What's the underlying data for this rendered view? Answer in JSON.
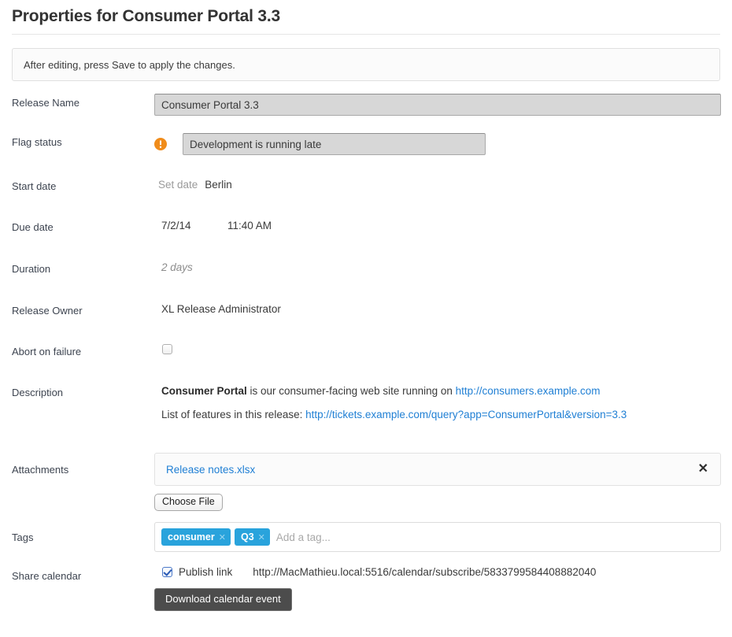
{
  "header": {
    "title": "Properties for Consumer Portal 3.3"
  },
  "banner": {
    "message": "After editing, press Save to apply the changes."
  },
  "fields": {
    "release_name": {
      "label": "Release Name",
      "value": "Consumer Portal 3.3"
    },
    "flag_status": {
      "label": "Flag status",
      "icon": "warning-exclamation-icon",
      "icon_color": "#f08c1b",
      "value": "Development is running late"
    },
    "start_date": {
      "label": "Start date",
      "placeholder": "Set date",
      "timezone": "Berlin"
    },
    "due_date": {
      "label": "Due date",
      "date": "7/2/14",
      "time": "11:40 AM"
    },
    "duration": {
      "label": "Duration",
      "value": "2 days"
    },
    "release_owner": {
      "label": "Release Owner",
      "value": "XL Release Administrator"
    },
    "abort_on_failure": {
      "label": "Abort on failure",
      "checked": false
    },
    "description": {
      "label": "Description",
      "line1_strong": "Consumer Portal",
      "line1_text": " is our consumer-facing web site running on ",
      "line1_link": "http://consumers.example.com",
      "line2_text": "List of features in this release: ",
      "line2_link": "http://tickets.example.com/query?app=ConsumerPortal&version=3.3"
    },
    "attachments": {
      "label": "Attachments",
      "file_name": "Release notes.xlsx",
      "remove_icon": "close-icon",
      "choose_file_label": "Choose File"
    },
    "tags": {
      "label": "Tags",
      "items": [
        "consumer",
        "Q3"
      ],
      "remove_icon": "tag-close-icon",
      "placeholder": "Add a tag...",
      "value": "",
      "color": "#29a3dc"
    },
    "share_calendar": {
      "label": "Share calendar",
      "publish_label": "Publish link",
      "publish_checked": true,
      "url": "http://MacMathieu.local:5516/calendar/subscribe/5833799584408882040",
      "download_button_label": "Download calendar event"
    }
  }
}
